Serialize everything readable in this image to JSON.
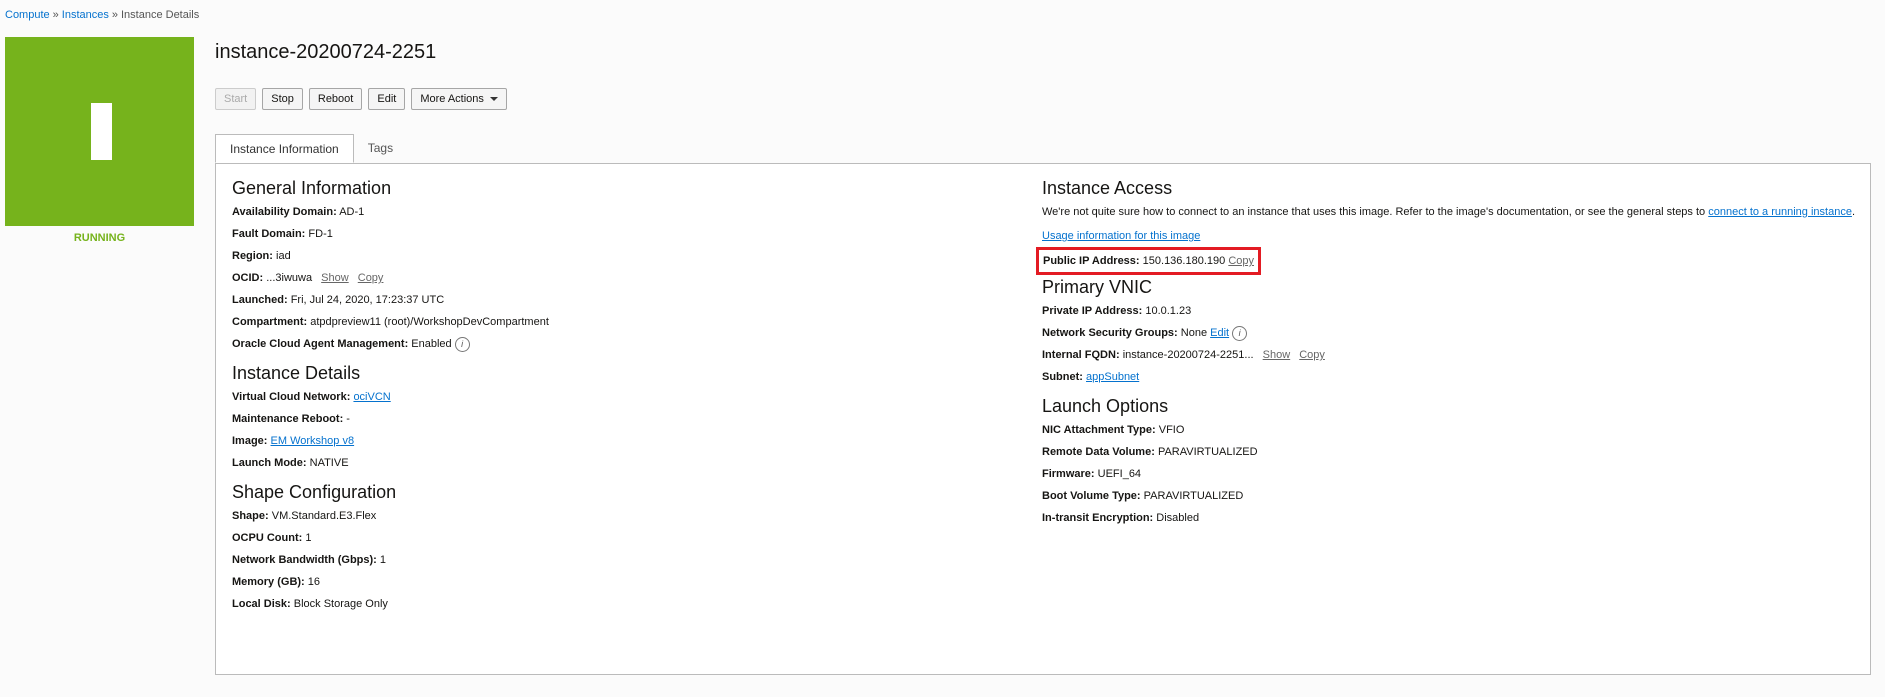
{
  "breadcrumb": {
    "compute": "Compute",
    "instances": "Instances",
    "current": "Instance Details",
    "sep": "»"
  },
  "instance": {
    "tile_letter": "I",
    "status": "RUNNING",
    "name": "instance-20200724-2251"
  },
  "actions": {
    "start": "Start",
    "stop": "Stop",
    "reboot": "Reboot",
    "edit": "Edit",
    "more": "More Actions"
  },
  "tabs": {
    "info": "Instance Information",
    "tags": "Tags"
  },
  "general": {
    "heading": "General Information",
    "availability_label": "Availability Domain:",
    "availability_value": "AD-1",
    "fault_label": "Fault Domain:",
    "fault_value": "FD-1",
    "region_label": "Region:",
    "region_value": "iad",
    "ocid_label": "OCID:",
    "ocid_value": "...3iwuwa",
    "show": "Show",
    "copy": "Copy",
    "launched_label": "Launched:",
    "launched_value": "Fri, Jul 24, 2020, 17:23:37 UTC",
    "compartment_label": "Compartment:",
    "compartment_value": "atpdpreview11 (root)/WorkshopDevCompartment",
    "agent_label": "Oracle Cloud Agent Management:",
    "agent_value": "Enabled"
  },
  "details": {
    "heading": "Instance Details",
    "vcn_label": "Virtual Cloud Network:",
    "vcn_value": "ociVCN",
    "maint_label": "Maintenance Reboot:",
    "maint_value": "-",
    "image_label": "Image:",
    "image_value": "EM Workshop v8",
    "mode_label": "Launch Mode:",
    "mode_value": "NATIVE"
  },
  "shape": {
    "heading": "Shape Configuration",
    "shape_label": "Shape:",
    "shape_value": "VM.Standard.E3.Flex",
    "ocpu_label": "OCPU Count:",
    "ocpu_value": "1",
    "bw_label": "Network Bandwidth (Gbps):",
    "bw_value": "1",
    "mem_label": "Memory (GB):",
    "mem_value": "16",
    "disk_label": "Local Disk:",
    "disk_value": "Block Storage Only"
  },
  "access": {
    "heading": "Instance Access",
    "text": "We're not quite sure how to connect to an instance that uses this image. Refer to the image's documentation, or see the general steps to",
    "link": "connect to a running instance",
    "period": ".",
    "usage_link": "Usage information for this image",
    "ip_label": "Public IP Address:",
    "ip_value": "150.136.180.190",
    "copy": "Copy"
  },
  "vnic": {
    "heading": "Primary VNIC",
    "private_label": "Private IP Address:",
    "private_value": "10.0.1.23",
    "nsg_label": "Network Security Groups:",
    "nsg_value": "None",
    "nsg_edit": "Edit",
    "fqdn_label": "Internal FQDN:",
    "fqdn_value": "instance-20200724-2251...",
    "show": "Show",
    "copy": "Copy",
    "subnet_label": "Subnet:",
    "subnet_value": "appSubnet"
  },
  "launch": {
    "heading": "Launch Options",
    "nic_label": "NIC Attachment Type:",
    "nic_value": "VFIO",
    "remote_label": "Remote Data Volume:",
    "remote_value": "PARAVIRTUALIZED",
    "fw_label": "Firmware:",
    "fw_value": "UEFI_64",
    "boot_label": "Boot Volume Type:",
    "boot_value": "PARAVIRTUALIZED",
    "transit_label": "In-transit Encryption:",
    "transit_value": "Disabled"
  },
  "colors": {
    "accent": "#76b31c",
    "link": "#0572ce",
    "highlight": "#e31b23"
  }
}
